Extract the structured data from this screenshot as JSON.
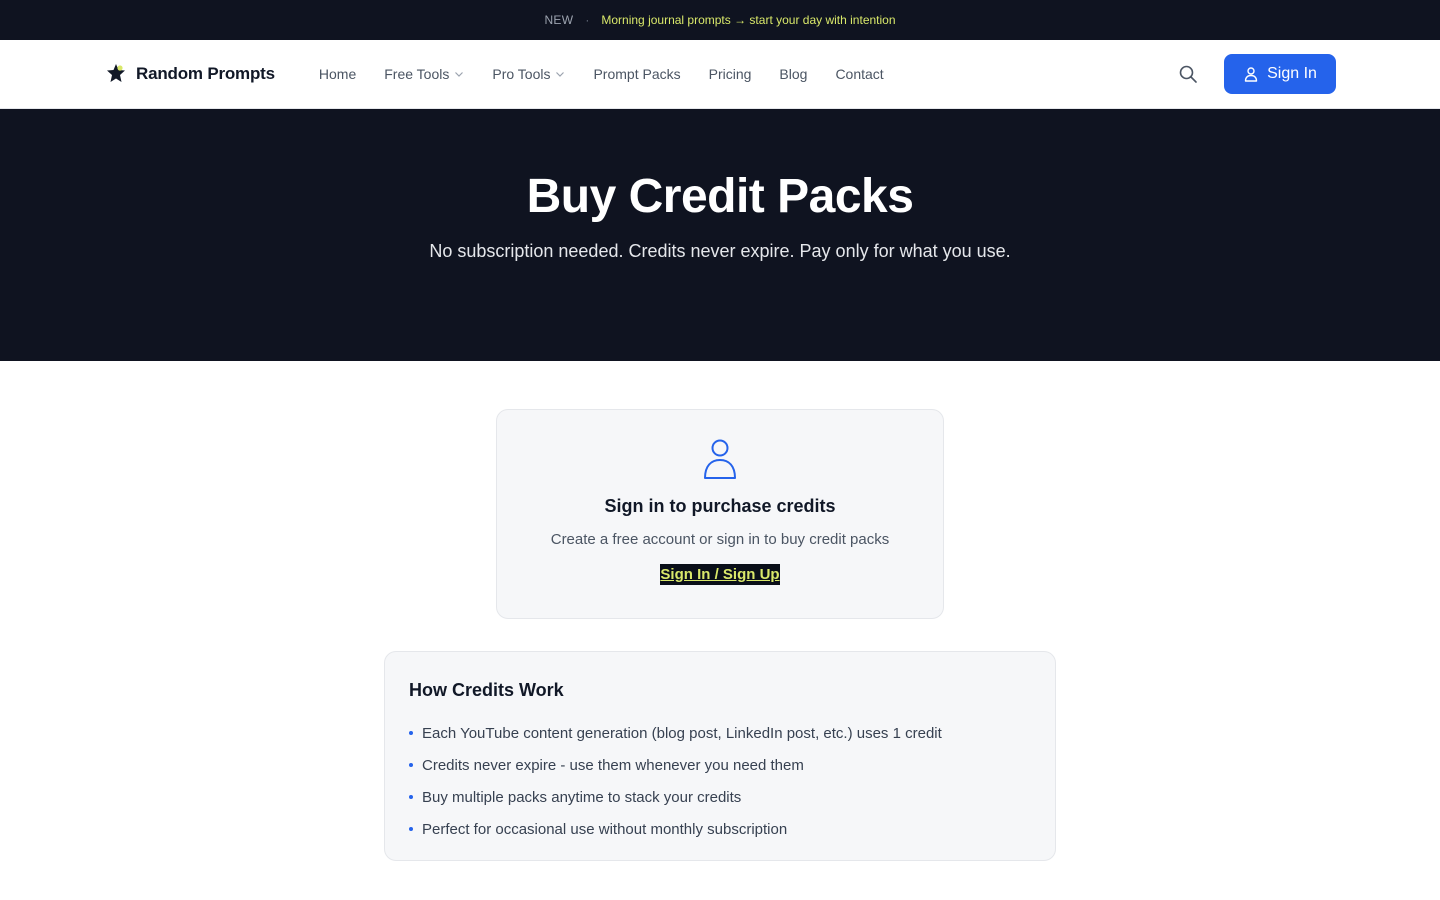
{
  "announcement": {
    "tag": "NEW",
    "separator": "·",
    "message": "Morning journal prompts → start your day with intention"
  },
  "header": {
    "brand": "Random Prompts",
    "nav": [
      {
        "label": "Home",
        "dropdown": false
      },
      {
        "label": "Free Tools",
        "dropdown": true
      },
      {
        "label": "Pro Tools",
        "dropdown": true
      },
      {
        "label": "Prompt Packs",
        "dropdown": false
      },
      {
        "label": "Pricing",
        "dropdown": false
      },
      {
        "label": "Blog",
        "dropdown": false
      },
      {
        "label": "Contact",
        "dropdown": false
      }
    ],
    "search_icon": "search-icon",
    "signin_label": "Sign In"
  },
  "hero": {
    "title": "Buy Credit Packs",
    "subtitle": "No subscription needed. Credits never expire. Pay only for what you use."
  },
  "signin_card": {
    "icon": "user-icon",
    "title": "Sign in to purchase credits",
    "description": "Create a free account or sign in to buy credit packs",
    "cta": "Sign In / Sign Up"
  },
  "how_credits": {
    "title": "How Credits Work",
    "items": [
      "Each YouTube content generation (blog post, LinkedIn post, etc.) uses 1 credit",
      "Credits never expire - use them whenever you need them",
      "Buy multiple packs anytime to stack your credits",
      "Perfect for occasional use without monthly subscription"
    ]
  },
  "colors": {
    "dark_bg": "#0f1320",
    "accent_blue": "#2563eb",
    "accent_yellow": "#d9e86a"
  }
}
